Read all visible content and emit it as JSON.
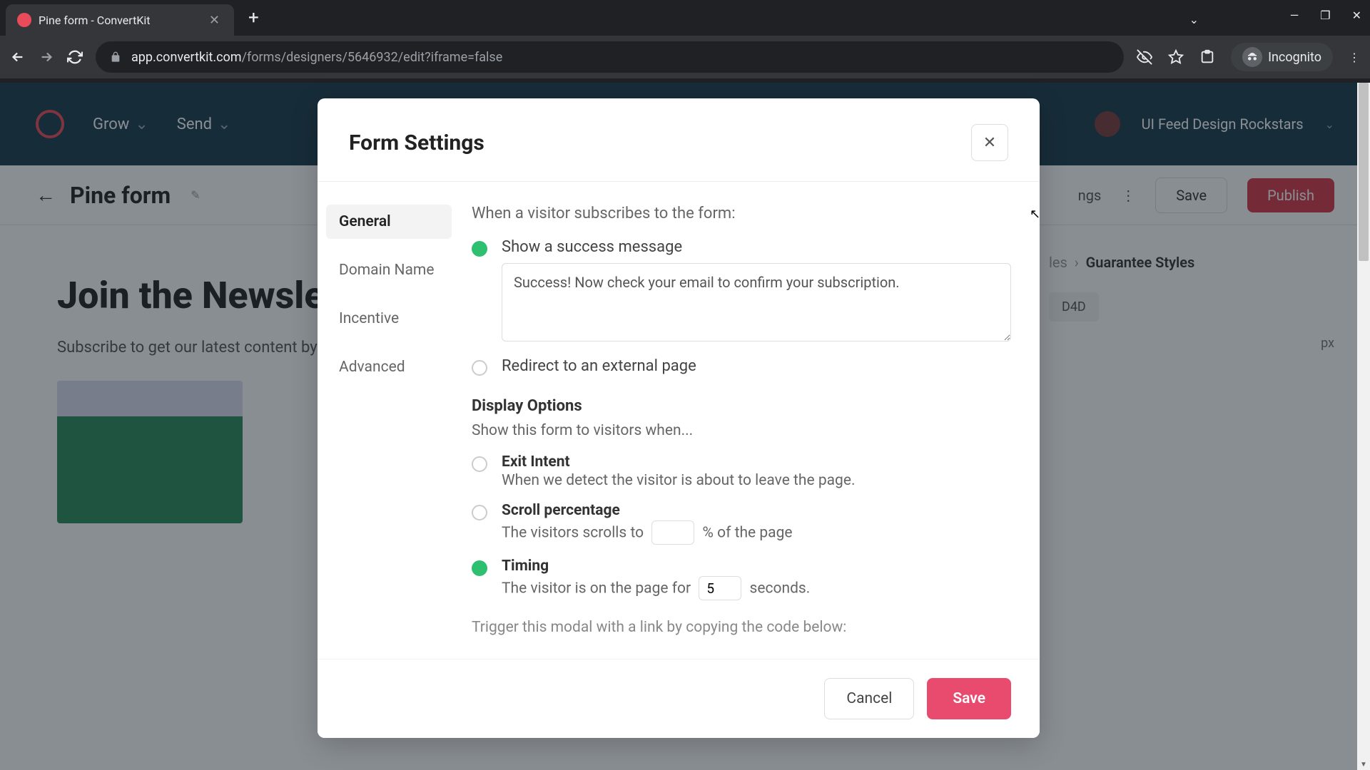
{
  "browser": {
    "tab_title": "Pine form - ConvertKit",
    "url_host": "app.convertkit.com",
    "url_path": "/forms/designers/5646932/edit?iframe=false",
    "incognito_label": "Incognito"
  },
  "app": {
    "nav": {
      "grow": "Grow",
      "send": "Send"
    },
    "account_name": "UI Feed Design Rockstars",
    "page_title": "Pine form",
    "toolbar": {
      "settings": "ngs",
      "save": "Save",
      "publish": "Publish"
    },
    "breadcrumb_prev": "les",
    "breadcrumb_current": "Guarantee Styles",
    "panel_value": "D4D",
    "panel_unit": "px",
    "preview_heading": "Join the Newsletter",
    "preview_text": "Subscribe to get our latest content by email."
  },
  "modal": {
    "title": "Form Settings",
    "tabs": {
      "general": "General",
      "domain": "Domain Name",
      "incentive": "Incentive",
      "advanced": "Advanced"
    },
    "subscribe_label": "When a visitor subscribes to the form:",
    "option_success": "Show a success message",
    "success_msg": "Success! Now check your email to confirm your subscription.",
    "option_redirect": "Redirect to an external page",
    "display_heading": "Display Options",
    "display_sub": "Show this form to visitors when...",
    "exit_title": "Exit Intent",
    "exit_desc": "When we detect the visitor is about to leave the page.",
    "scroll_title": "Scroll percentage",
    "scroll_desc_pre": "The visitors scrolls to",
    "scroll_value": "",
    "scroll_desc_post": "% of the page",
    "timing_title": "Timing",
    "timing_desc_pre": "The visitor is on the page for",
    "timing_value": "5",
    "timing_desc_post": "seconds.",
    "trigger_text": "Trigger this modal with a link by copying the code below:",
    "cancel": "Cancel",
    "save": "Save"
  }
}
